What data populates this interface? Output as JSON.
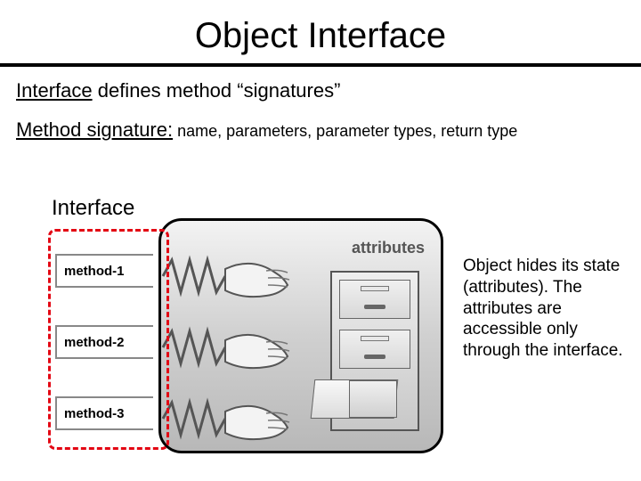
{
  "title": "Object Interface",
  "line1": {
    "lead": "Interface",
    "rest": " defines method “signatures”"
  },
  "line2": {
    "lead": "Method signature:",
    "sub": " name, parameters, parameter types, return type"
  },
  "diagram": {
    "interface_label": "Interface",
    "methods": [
      "method-1",
      "method-2",
      "method-3"
    ],
    "attributes_label": "attributes",
    "explain": "Object hides its state (attributes). The attributes are accessible only through the interface."
  }
}
